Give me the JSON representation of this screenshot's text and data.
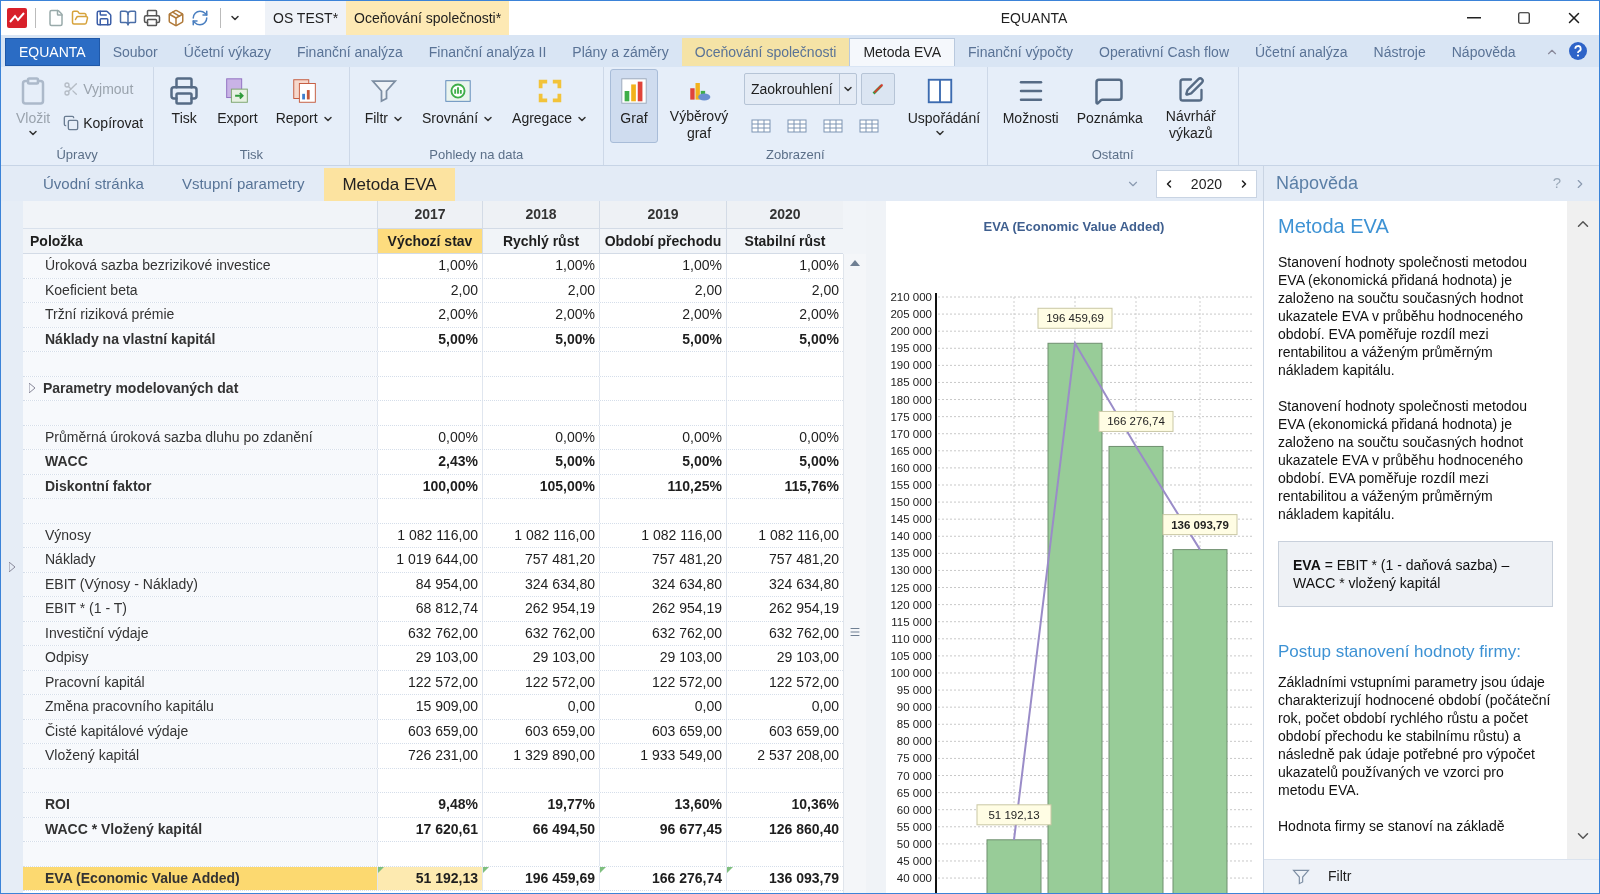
{
  "title_bar": {
    "documents": [
      {
        "label": "OS TEST*",
        "selected": false
      },
      {
        "label": "Oceňování společnosti*",
        "selected": true
      }
    ],
    "title": "EQUANTA"
  },
  "ribbon_tabs": [
    {
      "label": "EQUANTA",
      "kind": "app",
      "selected": false
    },
    {
      "label": "Soubor",
      "kind": "tab",
      "selected": false
    },
    {
      "label": "Účetní výkazy",
      "kind": "tab",
      "selected": false
    },
    {
      "label": "Finanční analýza",
      "kind": "tab",
      "selected": false
    },
    {
      "label": "Finanční analýza II",
      "kind": "tab",
      "selected": false
    },
    {
      "label": "Plány a záměry",
      "kind": "tab",
      "selected": false
    },
    {
      "label": "Oceňování společnosti",
      "kind": "context",
      "selected": false
    },
    {
      "label": "Metoda EVA",
      "kind": "tab",
      "selected": true
    },
    {
      "label": "Finanční výpočty",
      "kind": "tab",
      "selected": false
    },
    {
      "label": "Operativní Cash flow",
      "kind": "tab",
      "selected": false
    },
    {
      "label": "Účetní analýza",
      "kind": "tab",
      "selected": false
    },
    {
      "label": "Nástroje",
      "kind": "tab",
      "selected": false
    },
    {
      "label": "Nápověda",
      "kind": "tab",
      "selected": false
    }
  ],
  "ribbon_groups": [
    {
      "label": "Úpravy",
      "items": [
        {
          "kind": "large",
          "label": "Vložit",
          "disabled": true,
          "dropdown": true
        },
        {
          "kind": "stack",
          "buttons": [
            {
              "label": "Vyjmout",
              "disabled": true
            },
            {
              "label": "Kopírovat",
              "disabled": false
            }
          ]
        }
      ]
    },
    {
      "label": "Tisk",
      "items": [
        {
          "kind": "large",
          "label": "Tisk"
        },
        {
          "kind": "large",
          "label": "Export"
        },
        {
          "kind": "split",
          "label": "Report"
        }
      ]
    },
    {
      "label": "Pohledy na data",
      "items": [
        {
          "kind": "split",
          "label": "Filtr"
        },
        {
          "kind": "split",
          "label": "Srovnání"
        },
        {
          "kind": "split",
          "label": "Agregace"
        }
      ]
    },
    {
      "label": "Zobrazení",
      "items": [
        {
          "kind": "large",
          "label": "Graf",
          "pressed": true
        },
        {
          "kind": "large",
          "label": "Výběrový graf",
          "pressed": false
        },
        {
          "kind": "combo",
          "value": "Zaokrouhlení"
        },
        {
          "kind": "large",
          "label": "Uspořádání",
          "dropdown": true
        }
      ]
    },
    {
      "label": "Ostatní",
      "items": [
        {
          "kind": "large",
          "label": "Možnosti"
        },
        {
          "kind": "large",
          "label": "Poznámka"
        },
        {
          "kind": "large",
          "label": "Návrhář výkazů"
        }
      ]
    }
  ],
  "doc_tabs": [
    {
      "label": "Úvodní stránka",
      "selected": false
    },
    {
      "label": "Vstupní parametry",
      "selected": false
    },
    {
      "label": "Metoda EVA",
      "selected": true
    }
  ],
  "year_selector": {
    "value": "2020"
  },
  "table": {
    "years": [
      "2017",
      "2018",
      "2019",
      "2020"
    ],
    "item_header": "Položka",
    "phases": [
      {
        "label": "Výchozí stav",
        "selected": true
      },
      {
        "label": "Rychlý růst",
        "selected": false
      },
      {
        "label": "Období přechodu",
        "selected": false
      },
      {
        "label": "Stabilní růst",
        "selected": false
      }
    ],
    "rows": [
      {
        "kind": "normal",
        "label": "Úroková sazba bezrizikové investice",
        "values": [
          "1,00%",
          "1,00%",
          "1,00%",
          "1,00%"
        ]
      },
      {
        "kind": "normal",
        "label": "Koeficient beta",
        "values": [
          "2,00",
          "2,00",
          "2,00",
          "2,00"
        ]
      },
      {
        "kind": "normal",
        "label": "Tržní riziková prémie",
        "values": [
          "2,00%",
          "2,00%",
          "2,00%",
          "2,00%"
        ]
      },
      {
        "kind": "bold",
        "label": "Náklady na vlastní kapitál",
        "values": [
          "5,00%",
          "5,00%",
          "5,00%",
          "5,00%"
        ]
      },
      {
        "kind": "spacer"
      },
      {
        "kind": "group",
        "label": "Parametry modelovaných dat",
        "expanded": false
      },
      {
        "kind": "spacer"
      },
      {
        "kind": "normal",
        "label": "Průměrná úroková sazba dluhu po zdanění",
        "values": [
          "0,00%",
          "0,00%",
          "0,00%",
          "0,00%"
        ]
      },
      {
        "kind": "bold",
        "label": "WACC",
        "values": [
          "2,43%",
          "5,00%",
          "5,00%",
          "5,00%"
        ]
      },
      {
        "kind": "bold",
        "label": "Diskontní faktor",
        "values": [
          "100,00%",
          "105,00%",
          "110,25%",
          "115,76%"
        ]
      },
      {
        "kind": "spacer"
      },
      {
        "kind": "normal",
        "label": "Výnosy",
        "values": [
          "1 082 116,00",
          "1 082 116,00",
          "1 082 116,00",
          "1 082 116,00"
        ]
      },
      {
        "kind": "normal",
        "label": "Náklady",
        "values": [
          "1 019 644,00",
          "757 481,20",
          "757 481,20",
          "757 481,20"
        ]
      },
      {
        "kind": "normal",
        "label": "EBIT (Výnosy - Náklady)",
        "values": [
          "84 954,00",
          "324 634,80",
          "324 634,80",
          "324 634,80"
        ]
      },
      {
        "kind": "normal",
        "label": "EBIT * (1 - T)",
        "values": [
          "68 812,74",
          "262 954,19",
          "262 954,19",
          "262 954,19"
        ]
      },
      {
        "kind": "normal",
        "label": "Investiční výdaje",
        "values": [
          "632 762,00",
          "632 762,00",
          "632 762,00",
          "632 762,00"
        ]
      },
      {
        "kind": "normal",
        "label": "Odpisy",
        "values": [
          "29 103,00",
          "29 103,00",
          "29 103,00",
          "29 103,00"
        ]
      },
      {
        "kind": "normal",
        "label": "Pracovní kapitál",
        "values": [
          "122 572,00",
          "122 572,00",
          "122 572,00",
          "122 572,00"
        ]
      },
      {
        "kind": "normal",
        "label": "Změna pracovního kapitálu",
        "values": [
          "15 909,00",
          "0,00",
          "0,00",
          "0,00"
        ]
      },
      {
        "kind": "normal",
        "label": "Čisté kapitálové výdaje",
        "values": [
          "603 659,00",
          "603 659,00",
          "603 659,00",
          "603 659,00"
        ]
      },
      {
        "kind": "normal",
        "label": "Vložený kapitál",
        "values": [
          "726 231,00",
          "1 329 890,00",
          "1 933 549,00",
          "2 537 208,00"
        ]
      },
      {
        "kind": "spacer"
      },
      {
        "kind": "bold",
        "label": "ROI",
        "values": [
          "9,48%",
          "19,77%",
          "13,60%",
          "10,36%"
        ]
      },
      {
        "kind": "bold",
        "label": "WACC * Vložený kapitál",
        "values": [
          "17 620,61",
          "66 494,50",
          "96 677,45",
          "126 860,40"
        ]
      },
      {
        "kind": "spacer"
      },
      {
        "kind": "highlight",
        "label": "EVA (Economic Value Added)",
        "values": [
          "51 192,13",
          "196 459,69",
          "166 276,74",
          "136 093,79"
        ]
      }
    ]
  },
  "chart": {
    "chart_data": {
      "type": "bar",
      "title": "EVA (Economic Value Added)",
      "series": [
        {
          "color": "#98cc98",
          "values": [
            51192,
            196460,
            166277,
            136094
          ]
        }
      ],
      "ylim": [
        35000,
        210000
      ],
      "grid": true,
      "yticks": [
        {
          "value": 40000,
          "label": "40 000"
        },
        {
          "value": 45000,
          "label": "45 000"
        },
        {
          "value": 50000,
          "label": "50 000"
        },
        {
          "value": 55000,
          "label": "55 000"
        },
        {
          "value": 60000,
          "label": "60 000"
        },
        {
          "value": 65000,
          "label": "65 000"
        },
        {
          "value": 70000,
          "label": "70 000"
        },
        {
          "value": 75000,
          "label": "75 000"
        },
        {
          "value": 80000,
          "label": "80 000"
        },
        {
          "value": 85000,
          "label": "85 000"
        },
        {
          "value": 90000,
          "label": "90 000"
        },
        {
          "value": 95000,
          "label": "95 000"
        },
        {
          "value": 100000,
          "label": "100 000"
        },
        {
          "value": 105000,
          "label": "105 000"
        },
        {
          "value": 110000,
          "label": "110 000"
        },
        {
          "value": 115000,
          "label": "115 000"
        },
        {
          "value": 120000,
          "label": "120 000"
        },
        {
          "value": 125000,
          "label": "125 000"
        },
        {
          "value": 130000,
          "label": "130 000"
        },
        {
          "value": 135000,
          "label": "135 000"
        },
        {
          "value": 140000,
          "label": "140 000"
        },
        {
          "value": 145000,
          "label": "145 000"
        },
        {
          "value": 150000,
          "label": "150 000"
        },
        {
          "value": 155000,
          "label": "155 000"
        },
        {
          "value": 160000,
          "label": "160 000"
        },
        {
          "value": 165000,
          "label": "165 000"
        },
        {
          "value": 170000,
          "label": "170 000"
        },
        {
          "value": 175000,
          "label": "175 000"
        },
        {
          "value": 180000,
          "label": "180 000"
        },
        {
          "value": 185000,
          "label": "185 000"
        },
        {
          "value": 190000,
          "label": "190 000"
        },
        {
          "value": 195000,
          "label": "195 000"
        },
        {
          "value": 200000,
          "label": "200 000"
        },
        {
          "value": 205000,
          "label": "205 000"
        },
        {
          "value": 210000,
          "label": "210 000"
        }
      ],
      "value_labels": [
        "51 192,13",
        "196 459,69",
        "166 276,74",
        "136 093,79"
      ]
    }
  },
  "help": {
    "header": "Nápověda",
    "help_button": "?",
    "title": "Metoda EVA",
    "paragraphs": [
      "Stanovení hodnoty společnosti metodou EVA (ekonomická přidaná hodnota) je založeno na součtu současných hodnot ukazatele EVA v průběhu hodnoceného období. EVA poměřuje rozdíl mezi rentabilitou a váženým průměrným nákladem kapitálu.",
      "Stanovení hodnoty společnosti metodou EVA (ekonomická přidaná hodnota) je založeno na součtu současných hodnot ukazatele EVA v průběhu hodnoceného období. EVA poměřuje rozdíl mezi rentabilitou a váženým průměrným nákladem kapitálu."
    ],
    "formula": "**EVA** = EBIT * (1 - daňová sazba) – WACC * vložený kapitál",
    "subtitle": "Postup stanovení hodnoty firmy:",
    "paragraphs2": [
      "Základními vstupními parametry jsou údaje charakterizují hodnocené období (počáteční rok, počet období rychlého růstu a počet období přechodu ke stabilnímu růstu) a následně pak údaje potřebné pro výpočet ukazatelů používaných ve vzorci pro metodu EVA.",
      "Hodnota firmy se stanoví na základě"
    ],
    "footer": "Filtr"
  }
}
